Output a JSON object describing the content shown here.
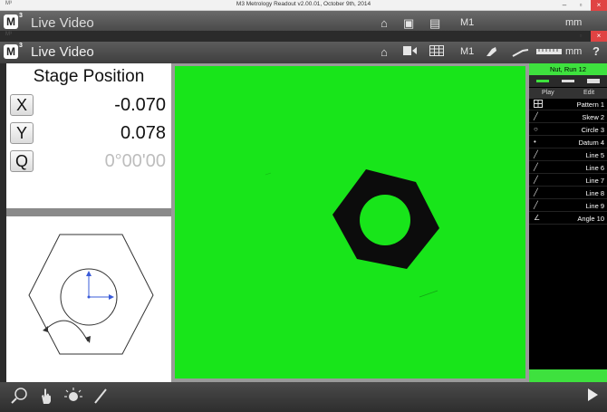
{
  "window": {
    "title": "M3 Metrology Readout  v2.00.01, October 9th, 2014",
    "minimize": "–",
    "maximize": "▫",
    "close": "×"
  },
  "toolbar": {
    "logo": "M",
    "logo_sup": "3",
    "title": "Live Video",
    "m1_label": "M1",
    "units": "mm",
    "help": "?",
    "icons": [
      "home-icon",
      "video-icon",
      "grid-icon",
      "probe-icon",
      "edge-tool-icon",
      "ruler-icon"
    ]
  },
  "stage": {
    "title": "Stage Position",
    "axes": [
      {
        "label": "X",
        "value": "-0.070"
      },
      {
        "label": "Y",
        "value": "0.078"
      },
      {
        "label": "Q",
        "value": "0°00'00"
      }
    ]
  },
  "right_panel": {
    "run_title": "Nut, Run 12",
    "play_label": "Play",
    "edit_label": "Edit",
    "features": [
      {
        "name": "Pattern 1",
        "icon": "pattern-icon"
      },
      {
        "name": "Skew 2",
        "icon": "skew-icon"
      },
      {
        "name": "Circle 3",
        "icon": "circle-icon"
      },
      {
        "name": "Datum 4",
        "icon": "datum-icon"
      },
      {
        "name": "Line 5",
        "icon": "line-icon"
      },
      {
        "name": "Line 6",
        "icon": "line-icon"
      },
      {
        "name": "Line 7",
        "icon": "line-icon"
      },
      {
        "name": "Line 8",
        "icon": "line-icon"
      },
      {
        "name": "Line 9",
        "icon": "line-icon"
      },
      {
        "name": "Angle 10",
        "icon": "angle-icon"
      }
    ]
  },
  "bottom_toolbar": {
    "icons": [
      "zoom-icon",
      "hand-touch-icon",
      "light-icon",
      "pen-icon",
      "play-icon"
    ]
  },
  "colors": {
    "video_background": "#18e51a",
    "accent_green": "#3ee13e",
    "toolbar_dark": "#3e3e3e"
  }
}
